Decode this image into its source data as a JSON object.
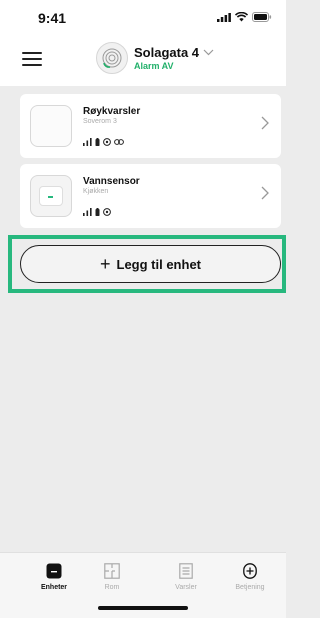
{
  "status_bar": {
    "time": "9:41"
  },
  "header": {
    "site_name": "Solagata 4",
    "site_status": "Alarm AV"
  },
  "devices": [
    {
      "name": "Røykvarsler",
      "room": "Soverom 3"
    },
    {
      "name": "Vannsensor",
      "room": "Kjøkken"
    }
  ],
  "add_device": {
    "plus": "+",
    "label": "Legg til enhet"
  },
  "tabs": [
    {
      "label": "Enheter"
    },
    {
      "label": "Rom"
    },
    {
      "label": "Varsler"
    },
    {
      "label": "Betjening"
    }
  ],
  "colors": {
    "accent": "#27b87e",
    "alarm_status": "#21b06a",
    "text": "#111111",
    "muted": "#aaaaaa",
    "background": "#ececec"
  },
  "icons": {
    "menu": "hamburger-icon",
    "logo": "site-logo-icon",
    "dropdown": "chevron-down-icon",
    "signal": "signal-icon",
    "battery": "battery-icon",
    "status": "device-status-icon",
    "link": "link-icon",
    "chevron": "chevron-right-icon",
    "tab_devices": "devices-icon",
    "tab_rooms": "floorplan-icon",
    "tab_notifications": "list-icon",
    "tab_control": "control-icon"
  }
}
